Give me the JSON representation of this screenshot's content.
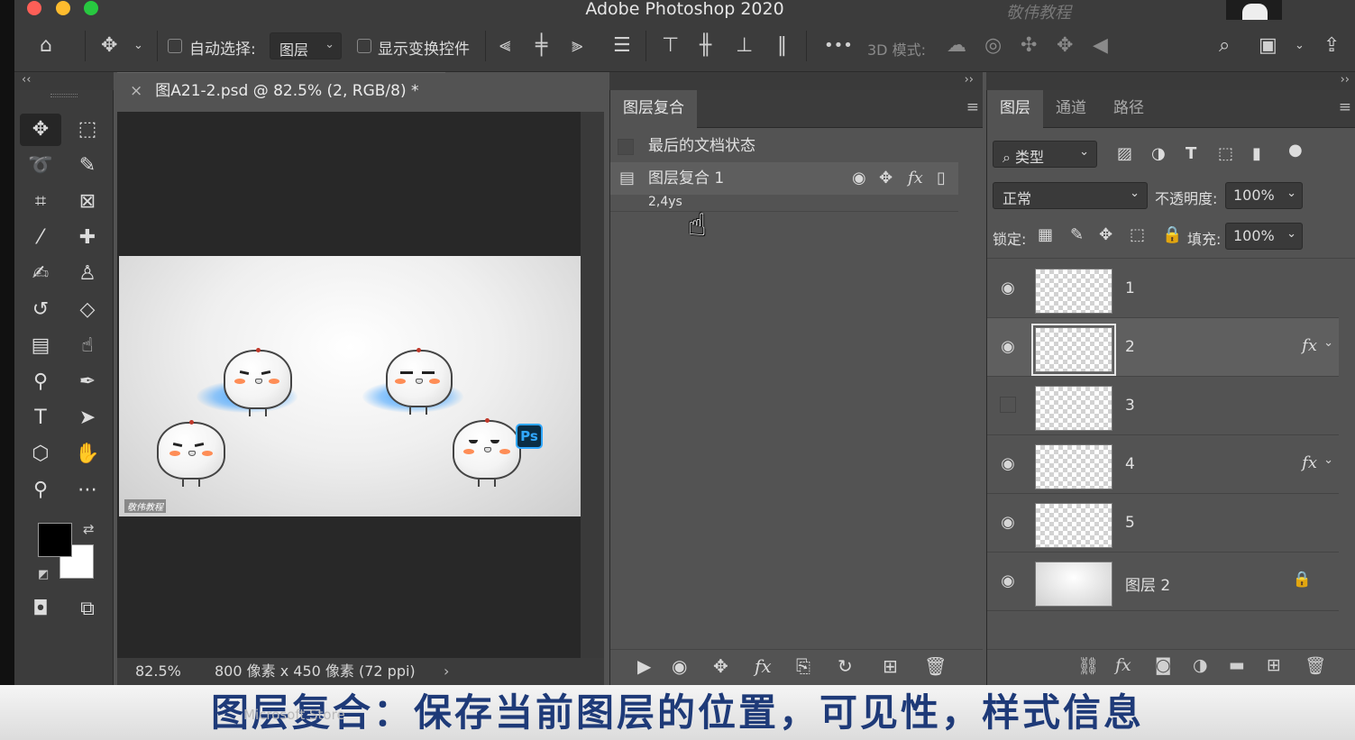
{
  "app": {
    "title": "Adobe Photoshop 2020",
    "watermark": "敬伟教程"
  },
  "options_bar": {
    "auto_select_label": "自动选择:",
    "auto_select_value": "图层",
    "show_transform_label": "显示变换控件",
    "mode_3d_label": "3D 模式:",
    "more": "•••"
  },
  "document": {
    "tab_title": "图A21-2.psd @ 82.5% (2, RGB/8) *",
    "zoom": "82.5%",
    "dimensions": "800 像素 x 450 像素 (72 ppi)",
    "canvas_watermark": "敬伟教程",
    "ps_badge": "Ps"
  },
  "comps_panel": {
    "tab": "图层复合",
    "rows": [
      {
        "label": "最后的文档状态"
      },
      {
        "label": "图层复合 1"
      }
    ],
    "sub_text": "2,4ys"
  },
  "layers_panel": {
    "tabs": [
      "图层",
      "通道",
      "路径"
    ],
    "filter_label": "类型",
    "blend_mode": "正常",
    "opacity_label": "不透明度:",
    "opacity_value": "100%",
    "lock_label": "锁定:",
    "fill_label": "填充:",
    "fill_value": "100%",
    "layers": [
      {
        "name": "1",
        "visible": true,
        "fx": false
      },
      {
        "name": "2",
        "visible": true,
        "fx": true,
        "selected": true
      },
      {
        "name": "3",
        "visible": false,
        "fx": false
      },
      {
        "name": "4",
        "visible": true,
        "fx": true
      },
      {
        "name": "5",
        "visible": true,
        "fx": false
      },
      {
        "name": "图层 2",
        "visible": true,
        "fx": false,
        "locked": true
      }
    ],
    "fx_label": "fx",
    "fx_bottom": "fx"
  },
  "subtitle": {
    "text": "图层复合：保存当前图层的位置，可见性，样式信息",
    "overlay": "Microsoft Store"
  },
  "colors": {
    "panel": "#535353",
    "bar": "#3c3c3c",
    "subtitle_text": "#1e3a78",
    "glow": "#3ca0ff"
  }
}
